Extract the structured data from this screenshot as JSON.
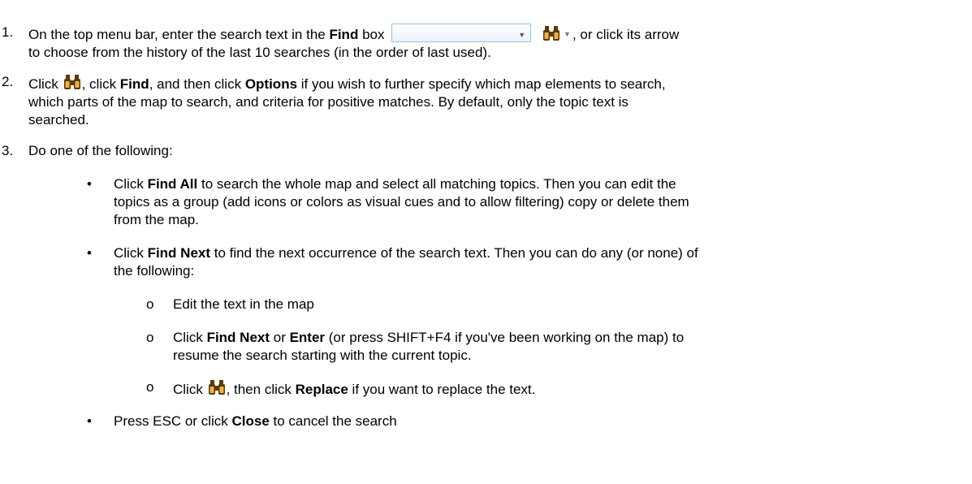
{
  "steps": [
    {
      "number": "1.",
      "parts": {
        "a": "On the top menu bar, enter the search text in the ",
        "b": "Find",
        "c": " box",
        "d": ", or click its arrow",
        "e": "to choose from the history of the last 10 searches (in the order of last used)."
      }
    },
    {
      "number": "2.",
      "parts": {
        "a": "Click ",
        "b": ", click ",
        "c": "Find",
        "d": ", and then click ",
        "e": "Options",
        "f": " if you wish to further specify which map elements to search,",
        "g": "which parts of the map to search, and criteria for positive matches. By default, only the topic text is",
        "h": "searched."
      }
    },
    {
      "number": "3.",
      "text": "Do one of the following:"
    }
  ],
  "bullets": [
    {
      "symbol": "•",
      "a": "Click ",
      "b": "Find All",
      "c": " to search the whole map and select all matching topics. Then you can edit the",
      "d": "topics as a group (add icons or colors as visual cues and to allow filtering) copy or delete them",
      "e": "from the map."
    },
    {
      "symbol": "•",
      "a": "Click ",
      "b": "Find Next",
      "c": " to find the next occurrence of the search text. Then you can do any (or none) of",
      "d": "the following:"
    },
    {
      "symbol": "•",
      "a": "Press ESC or click ",
      "b": "Close",
      "c": " to cancel the search"
    }
  ],
  "subbullets": [
    {
      "symbol": "o",
      "text": "Edit the text in the map"
    },
    {
      "symbol": "o",
      "a": "Click ",
      "b": "Find Next",
      "c": " or ",
      "d": "Enter",
      "e": " (or press SHIFT+F4 if you've been working on the map) to",
      "f": "resume the search starting with the current topic."
    },
    {
      "symbol": "o",
      "a": "Click ",
      "b": ", then click ",
      "c": "Replace",
      "d": " if you want to replace the text."
    }
  ],
  "icons": {
    "find": "binoculars-icon",
    "dropdown": "chevron-down-icon"
  },
  "colors": {
    "binoculars_dark": "#5a3a08",
    "binoculars_light": "#f0b43c",
    "findbox_border": "#9cc0de"
  }
}
